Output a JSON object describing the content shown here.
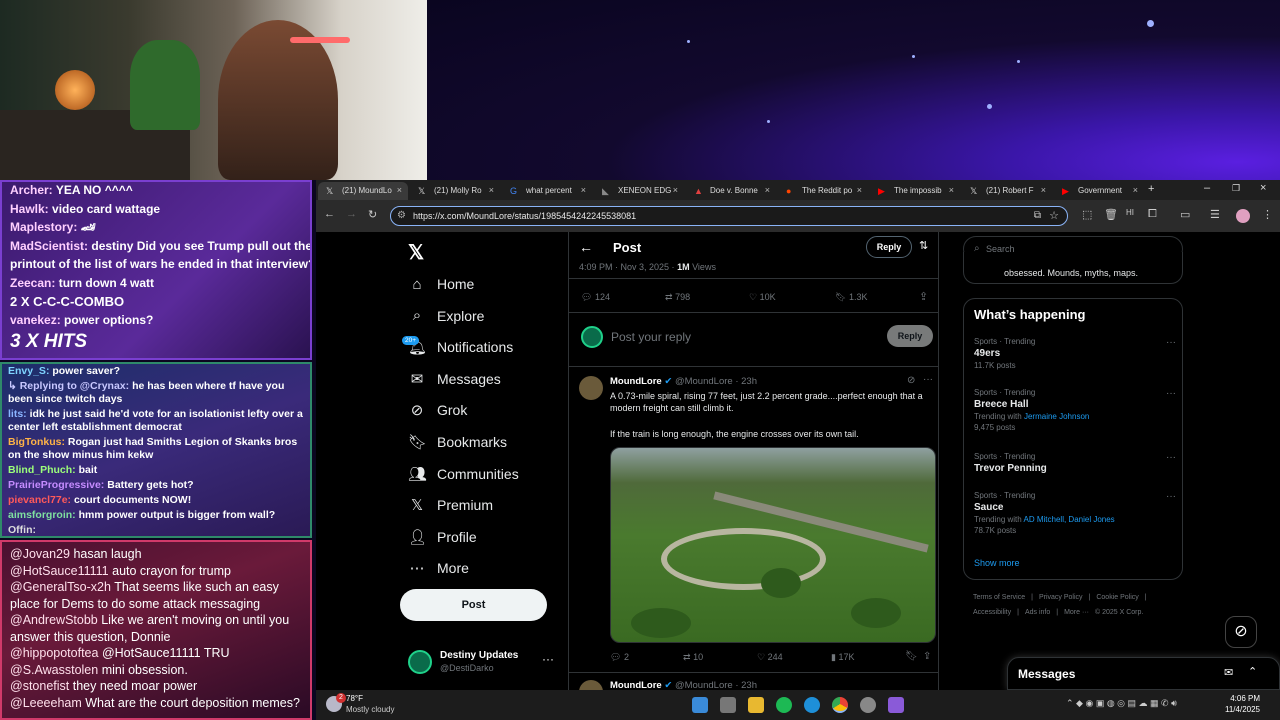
{
  "chat_top": [
    {
      "user": "Archer:",
      "text": "YEA NO ^^^^"
    },
    {
      "user": "Hawlk:",
      "text": "video card wattage"
    },
    {
      "user": "Maplestory:",
      "text": "🏎"
    },
    {
      "user": "MadScientist:",
      "text": "destiny Did you see Trump pull out the"
    },
    {
      "user": "",
      "text": "printout of the list of wars he ended in that interview?"
    },
    {
      "user": "Zeecan:",
      "text": "turn down 4 watt"
    },
    {
      "user": "",
      "text": "2 X C-C-C-COMBO"
    },
    {
      "user": "vanekez:",
      "text": "power options?"
    },
    {
      "user": "",
      "text": "3 X HITS"
    }
  ],
  "chat_mid": [
    {
      "user": "Envy_S:",
      "text": "power saver?",
      "color": "#7fd4ff"
    },
    {
      "user": "↳ Replying to @Crynax:",
      "text": "he has been where tf have you been since twitch days",
      "color": "#c8c8ff"
    },
    {
      "user": "lits:",
      "text": "idk he just said he'd vote for an isolationist lefty over a center left establishment democrat",
      "color": "#8ab4ff"
    },
    {
      "user": "BigTonkus:",
      "text": "Rogan just had Smiths Legion of Skanks bros on the show minus him kekw",
      "color": "#ffb347"
    },
    {
      "user": "Blind_Phuch:",
      "text": "bait",
      "color": "#9cff7a"
    },
    {
      "user": "PrairieProgressive:",
      "text": "Battery gets hot?",
      "color": "#c58cff"
    },
    {
      "user": "pievancl77e:",
      "text": "court documents NOW!",
      "color": "#ff5a5a"
    },
    {
      "user": "aimsforgroin:",
      "text": "hmm power output is bigger from wall?",
      "color": "#7fe0a0"
    },
    {
      "user": "Offin:",
      "text": "",
      "color": "#dddddd"
    }
  ],
  "chat_bottom": [
    {
      "user": "@Jovan29",
      "text": "hasan laugh"
    },
    {
      "user": "@HotSauce11111",
      "text": "auto crayon for trump"
    },
    {
      "user": "@GeneralTso-x2h",
      "text": "That seems like such an easy place for Dems to do some attack messaging"
    },
    {
      "user": "@AndrewStobb",
      "text": "Like we aren't moving on until you answer this question, Donnie"
    },
    {
      "user": "@hippopotoftea",
      "text": "@HotSauce11111 TRU"
    },
    {
      "user": "@S.Awasstolen",
      "text": "mini obsession."
    },
    {
      "user": "@stonefist",
      "text": "they need moar power"
    },
    {
      "user": "@Leeeeham",
      "text": "What are the court deposition memes?"
    }
  ],
  "tabs": [
    {
      "label": "(21) MoundLo",
      "icon": "x-icon"
    },
    {
      "label": "(21) Molly Ro",
      "icon": "x-icon"
    },
    {
      "label": "what percent",
      "icon": "google-icon"
    },
    {
      "label": "XENEON EDG",
      "icon": "corsair-icon"
    },
    {
      "label": "Doe v. Bonne",
      "icon": "pdf-icon"
    },
    {
      "label": "The Reddit po",
      "icon": "reddit-icon"
    },
    {
      "label": "The impossib",
      "icon": "youtube-icon"
    },
    {
      "label": "(21) Robert F",
      "icon": "x-icon"
    },
    {
      "label": "Government",
      "icon": "youtube-icon"
    }
  ],
  "url": "https://x.com/MoundLore/status/1985454242245538081",
  "nav": [
    "Home",
    "Explore",
    "Notifications",
    "Messages",
    "Grok",
    "Bookmarks",
    "Communities",
    "Premium",
    "Profile",
    "More"
  ],
  "notif_badge": "20+",
  "post_button": "Post",
  "account": {
    "name": "Destiny Updates",
    "handle": "@DestiDarko"
  },
  "header": {
    "title": "Post",
    "reply": "Reply"
  },
  "meta": {
    "time": "4:09 PM · Nov 3, 2025 ·",
    "views_count": "1M",
    "views_label": "Views"
  },
  "stats": {
    "replies": "124",
    "reposts": "798",
    "likes": "10K",
    "bookmarks": "1.3K"
  },
  "reply_box": {
    "placeholder": "Post your reply",
    "button": "Reply"
  },
  "tweet": {
    "name": "MoundLore",
    "handle": "@MoundLore",
    "time": "· 23h",
    "text1": "A 0.73-mile spiral, rising 77 feet, just 2.2 percent grade....perfect enough that a modern freight can still climb it.",
    "text2": "If the train is long enough, the engine crosses over its own tail.",
    "replies": "2",
    "reposts": "10",
    "likes": "244",
    "views": "17K"
  },
  "tweet2": {
    "name": "MoundLore",
    "handle": "@MoundLore",
    "time": "· 23h"
  },
  "search": {
    "placeholder": "Search"
  },
  "bio_snippet": "obsessed. Mounds, myths, maps.",
  "happening": {
    "title": "What’s happening",
    "trends": [
      {
        "cat": "Sports · Trending",
        "name": "49ers",
        "sub": "11.7K posts",
        "with": ""
      },
      {
        "cat": "Sports · Trending",
        "name": "Breece Hall",
        "sub": "9,475 posts",
        "with": "Trending with",
        "links": "Jermaine Johnson"
      },
      {
        "cat": "Sports · Trending",
        "name": "Trevor Penning",
        "sub": "",
        "with": ""
      },
      {
        "cat": "Sports · Trending",
        "name": "Sauce",
        "sub": "78.7K posts",
        "with": "Trending with",
        "links": "AD Mitchell, Daniel Jones"
      }
    ],
    "show_more": "Show more"
  },
  "footer": {
    "l1": [
      "Terms of Service",
      "|",
      "Privacy Policy",
      "|",
      "Cookie Policy",
      "|"
    ],
    "l2": [
      "Accessibility",
      "|",
      "Ads info",
      "|",
      "More ···",
      "© 2025 X Corp."
    ]
  },
  "messages_drawer": "Messages",
  "weather": {
    "temp": "78°F",
    "desc": "Mostly cloudy",
    "badge": "2"
  },
  "clock": {
    "time": "4:06 PM",
    "date": "11/4/2025"
  },
  "colors": {
    "accent": "#1d9bf0",
    "x_bg": "#000000",
    "link": "#1d9bf0"
  }
}
